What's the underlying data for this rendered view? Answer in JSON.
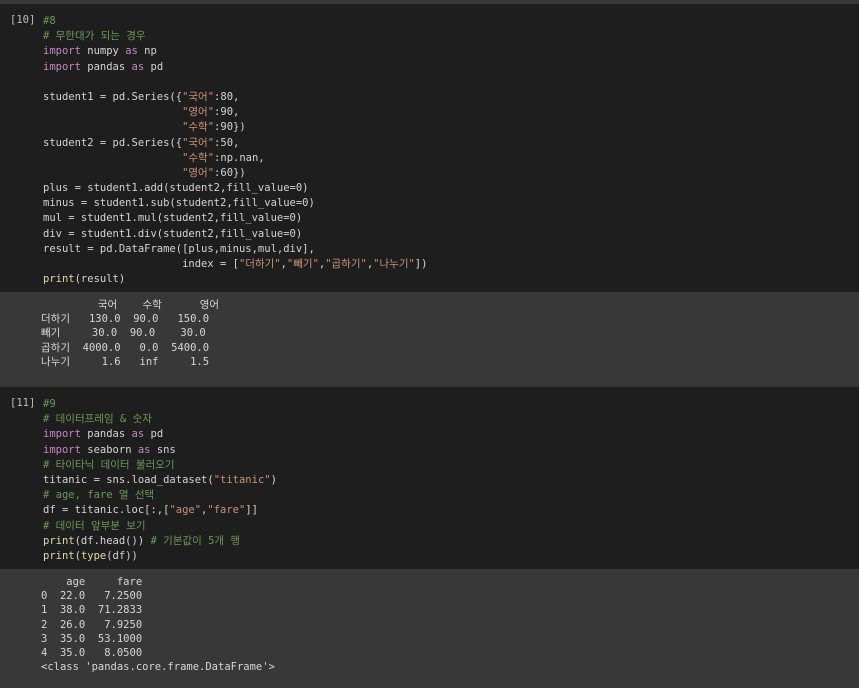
{
  "cells": [
    {
      "exec_count": "[10]",
      "lines": [
        [
          {
            "t": "#8",
            "c": "cm"
          }
        ],
        [
          {
            "t": "# 무한대가 되는 경우",
            "c": "cm"
          }
        ],
        [
          {
            "t": "import",
            "c": "kw"
          },
          {
            "t": " numpy ",
            "c": ""
          },
          {
            "t": "as",
            "c": "kw"
          },
          {
            "t": " np",
            "c": ""
          }
        ],
        [
          {
            "t": "import",
            "c": "kw"
          },
          {
            "t": " pandas ",
            "c": ""
          },
          {
            "t": "as",
            "c": "kw"
          },
          {
            "t": " pd",
            "c": ""
          }
        ],
        [],
        [
          {
            "t": "student1 = pd.Series({",
            "c": ""
          },
          {
            "t": "\"국어\"",
            "c": "str"
          },
          {
            "t": ":80,",
            "c": ""
          }
        ],
        [
          {
            "t": "                      ",
            "c": ""
          },
          {
            "t": "\"영어\"",
            "c": "str"
          },
          {
            "t": ":90,",
            "c": ""
          }
        ],
        [
          {
            "t": "                      ",
            "c": ""
          },
          {
            "t": "\"수학\"",
            "c": "str"
          },
          {
            "t": ":90})",
            "c": ""
          }
        ],
        [
          {
            "t": "student2 = pd.Series({",
            "c": ""
          },
          {
            "t": "\"국어\"",
            "c": "str"
          },
          {
            "t": ":50,",
            "c": ""
          }
        ],
        [
          {
            "t": "                      ",
            "c": ""
          },
          {
            "t": "\"수학\"",
            "c": "str"
          },
          {
            "t": ":np.nan,",
            "c": ""
          }
        ],
        [
          {
            "t": "                      ",
            "c": ""
          },
          {
            "t": "\"영어\"",
            "c": "str"
          },
          {
            "t": ":60})",
            "c": ""
          }
        ],
        [
          {
            "t": "plus = student1.add(student2,fill_value=0)",
            "c": ""
          }
        ],
        [
          {
            "t": "minus = student1.sub(student2,fill_value=0)",
            "c": ""
          }
        ],
        [
          {
            "t": "mul = student1.mul(student2,fill_value=0)",
            "c": ""
          }
        ],
        [
          {
            "t": "div = student1.div(student2,fill_value=0)",
            "c": ""
          }
        ],
        [
          {
            "t": "result = pd.DataFrame([plus,minus,mul,div],",
            "c": ""
          }
        ],
        [
          {
            "t": "                      index = [",
            "c": ""
          },
          {
            "t": "\"더하기\"",
            "c": "str"
          },
          {
            "t": ",",
            "c": ""
          },
          {
            "t": "\"빼기\"",
            "c": "str"
          },
          {
            "t": ",",
            "c": ""
          },
          {
            "t": "\"곱하기\"",
            "c": "str"
          },
          {
            "t": ",",
            "c": ""
          },
          {
            "t": "\"나누기\"",
            "c": "str"
          },
          {
            "t": "])",
            "c": ""
          }
        ],
        [
          {
            "t": "print",
            "c": "bi"
          },
          {
            "t": "(result)",
            "c": ""
          }
        ]
      ],
      "output": [
        "         국어    수학      영어",
        "더하기   130.0  90.0   150.0",
        "빼기     30.0  90.0    30.0",
        "곱하기  4000.0   0.0  5400.0",
        "나누기     1.6   inf     1.5"
      ]
    },
    {
      "exec_count": "[11]",
      "lines": [
        [
          {
            "t": "#9",
            "c": "cm"
          }
        ],
        [
          {
            "t": "# 데이터프레임 & 숫자",
            "c": "cm"
          }
        ],
        [
          {
            "t": "import",
            "c": "kw"
          },
          {
            "t": " pandas ",
            "c": ""
          },
          {
            "t": "as",
            "c": "kw"
          },
          {
            "t": " pd",
            "c": ""
          }
        ],
        [
          {
            "t": "import",
            "c": "kw"
          },
          {
            "t": " seaborn ",
            "c": ""
          },
          {
            "t": "as",
            "c": "kw"
          },
          {
            "t": " sns",
            "c": ""
          }
        ],
        [
          {
            "t": "# 타이타닉 데이터 불러오기",
            "c": "cm"
          }
        ],
        [
          {
            "t": "titanic = sns.load_dataset(",
            "c": ""
          },
          {
            "t": "\"titanic\"",
            "c": "str"
          },
          {
            "t": ")",
            "c": ""
          }
        ],
        [
          {
            "t": "# age, fare 열 선택",
            "c": "cm"
          }
        ],
        [
          {
            "t": "df = titanic.loc[:,[",
            "c": ""
          },
          {
            "t": "\"age\"",
            "c": "str"
          },
          {
            "t": ",",
            "c": ""
          },
          {
            "t": "\"fare\"",
            "c": "str"
          },
          {
            "t": "]]",
            "c": ""
          }
        ],
        [
          {
            "t": "# 데이터 앞부분 보기",
            "c": "cm"
          }
        ],
        [
          {
            "t": "print",
            "c": "bi"
          },
          {
            "t": "(df.head()) ",
            "c": ""
          },
          {
            "t": "# 기본값이 5개 행",
            "c": "cm"
          }
        ],
        [
          {
            "t": "print",
            "c": "bi"
          },
          {
            "t": "(",
            "c": ""
          },
          {
            "t": "type",
            "c": "bi"
          },
          {
            "t": "(df))",
            "c": ""
          }
        ]
      ],
      "output": [
        "    age     fare",
        "0  22.0   7.2500",
        "1  38.0  71.2833",
        "2  26.0   7.9250",
        "3  35.0  53.1000",
        "4  35.0   8.0500",
        "<class 'pandas.core.frame.DataFrame'>"
      ]
    }
  ]
}
